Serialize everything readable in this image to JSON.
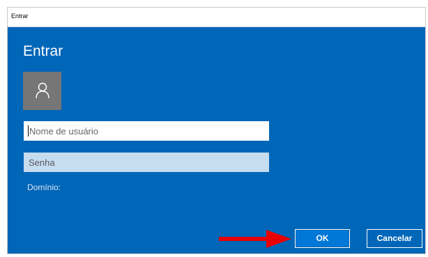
{
  "window": {
    "title": "Entrar"
  },
  "dialog": {
    "heading": "Entrar",
    "username_placeholder": "Nome de usuário",
    "password_placeholder": "Senha",
    "domain_label": "Domínio:"
  },
  "buttons": {
    "ok_label": "OK",
    "cancel_label": "Cancelar"
  },
  "icons": {
    "avatar": "user-icon",
    "annotation": "red-arrow-icon"
  },
  "colors": {
    "dialog_bg": "#0066b8",
    "accent_button": "#0078d7",
    "annotation": "#e80000"
  }
}
